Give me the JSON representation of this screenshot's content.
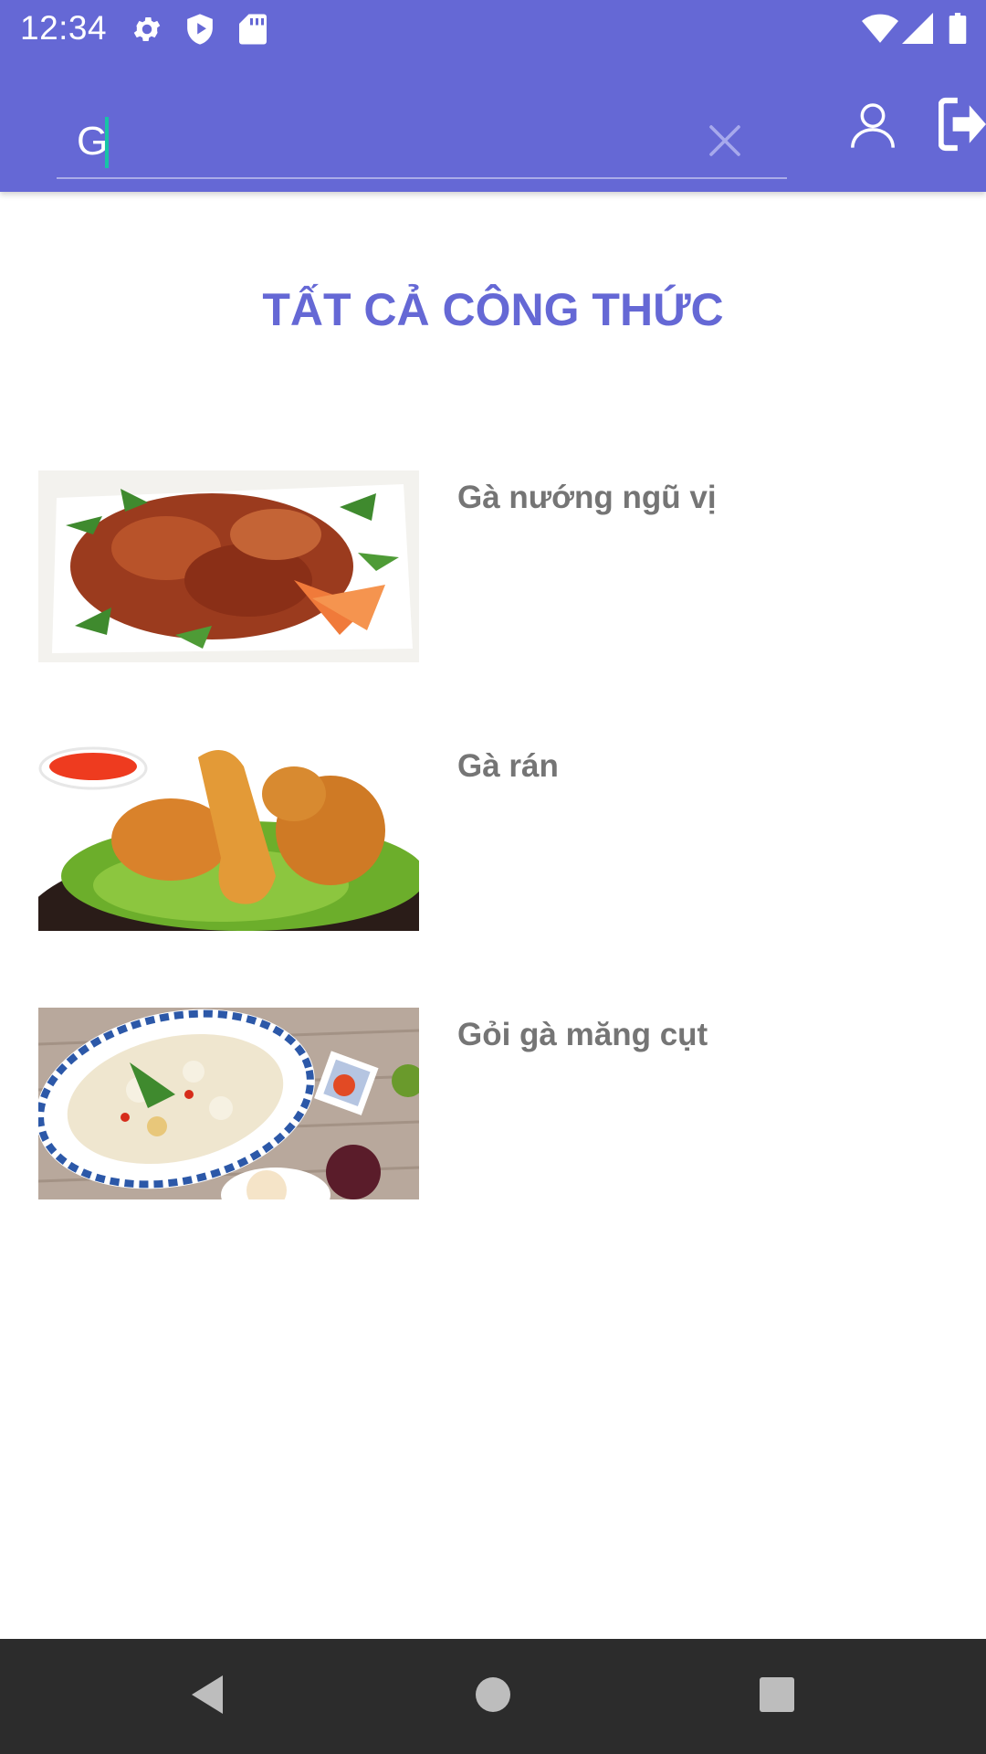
{
  "status_bar": {
    "time": "12:34",
    "icons_left": [
      "settings-icon",
      "shield-play-icon",
      "sd-card-icon"
    ],
    "icons_right": [
      "wifi-icon",
      "cellular-signal-icon",
      "battery-icon"
    ]
  },
  "app_bar": {
    "background_color": "#6568d5",
    "search": {
      "value": "G",
      "caret_color": "#17c4a6"
    },
    "actions": [
      "profile-icon",
      "logout-icon"
    ]
  },
  "page": {
    "title": "TẤT CẢ CÔNG THỨC",
    "title_color": "#6568d5"
  },
  "recipes": [
    {
      "name": "Gà nướng ngũ vị",
      "image": "grilled-chicken-photo"
    },
    {
      "name": "Gà rán",
      "image": "fried-chicken-photo"
    },
    {
      "name": "Gỏi gà măng cụt",
      "image": "chicken-mangosteen-salad-photo"
    }
  ],
  "nav_bar": {
    "buttons": [
      "back-icon",
      "home-icon",
      "recents-icon"
    ]
  }
}
